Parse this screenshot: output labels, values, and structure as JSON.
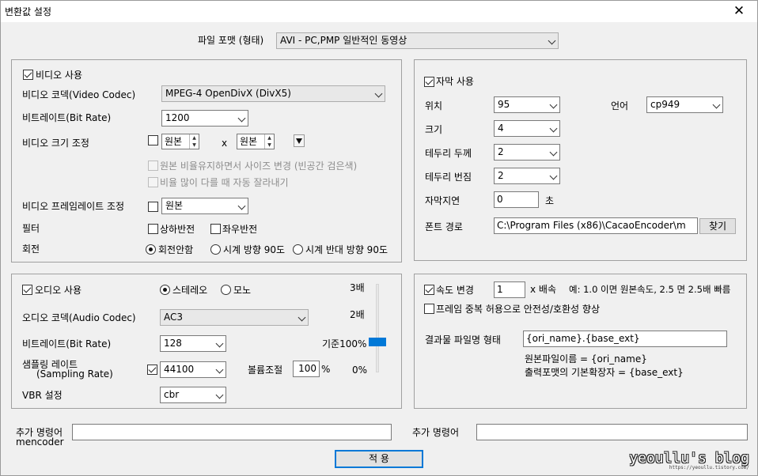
{
  "window": {
    "title": "변환값 설정",
    "close_icon": "✕"
  },
  "format": {
    "label": "파일 포맷 (형태)",
    "value": "AVI - PC,PMP 일반적인 동영상"
  },
  "video": {
    "use_label": "비디오 사용",
    "codec_label": "비디오 코덱(Video Codec)",
    "codec_value": "MPEG-4 OpenDivX (DivX5)",
    "bitrate_label": "비트레이트(Bit Rate)",
    "bitrate_value": "1200",
    "resize_label": "비디오 크기 조정",
    "width_value": "원본",
    "x_label": "x",
    "height_value": "원본",
    "keep_ratio_label": "원본 비율유지하면서 사이즈 변경 (빈공간 검은색)",
    "crop_label": "비율 많이 다를 때 자동 잘라내기",
    "framerate_label": "비디오 프레임레이트 조정",
    "framerate_value": "원본",
    "filter_label": "필터",
    "flip_v_label": "상하반전",
    "flip_h_label": "좌우반전",
    "rotate_label": "회전",
    "rotate_none": "회전안함",
    "rotate_cw": "시계 방향 90도",
    "rotate_ccw": "시계 반대 방향 90도"
  },
  "subtitle": {
    "use_label": "자막 사용",
    "position_label": "위치",
    "position_value": "95",
    "language_label": "언어",
    "language_value": "cp949",
    "size_label": "크기",
    "size_value": "4",
    "border_width_label": "테두리 두께",
    "border_width_value": "2",
    "border_blur_label": "테두리 번짐",
    "border_blur_value": "2",
    "delay_label": "자막지연",
    "delay_value": "0",
    "delay_unit": "초",
    "font_path_label": "폰트 경로",
    "font_path_value": "C:\\Program Files (x86)\\CacaoEncoder\\m",
    "browse_label": "찾기"
  },
  "audio": {
    "use_label": "오디오 사용",
    "stereo_label": "스테레오",
    "mono_label": "모노",
    "codec_label": "오디오 코덱(Audio Codec)",
    "codec_value": "AC3",
    "bitrate_label": "비트레이트(Bit Rate)",
    "bitrate_value": "128",
    "sampling_label_1": "샘플링 레이트",
    "sampling_label_2": "(Sampling Rate)",
    "sampling_value": "44100",
    "volume_label": "볼륨조절",
    "volume_value": "100",
    "volume_unit": "%",
    "vbr_label": "VBR 설정",
    "vbr_value": "cbr",
    "level_3x": "3배",
    "level_2x": "2배",
    "level_base": "기준100%",
    "level_0": "0%",
    "volume_level_fraction": 0.33
  },
  "speed": {
    "change_label": "속도 변경",
    "value": "1",
    "unit": "x 배속",
    "example": "예: 1.0 이면 원본속도, 2.5 면 2.5배 빠름",
    "dup_frame_label": "프레임 중복 허용으로 안전성/호환성 향상",
    "result_name_label": "결과물 파일명 형태",
    "result_name_value": "{ori_name}.{base_ext}",
    "help_1": "원본파일이름 = {ori_name}",
    "help_2": "출력포맷의 기본확장자 = {base_ext}"
  },
  "extra": {
    "mencoder_label_1": "추가 명령어",
    "mencoder_label_2": "mencoder",
    "mencoder_value": "",
    "other_label": "추가 명령어",
    "other_value": ""
  },
  "apply_label": "적 용",
  "watermark": {
    "main": "yeoullu's blog",
    "sub": "https://yeoullu.tistory.com/"
  }
}
